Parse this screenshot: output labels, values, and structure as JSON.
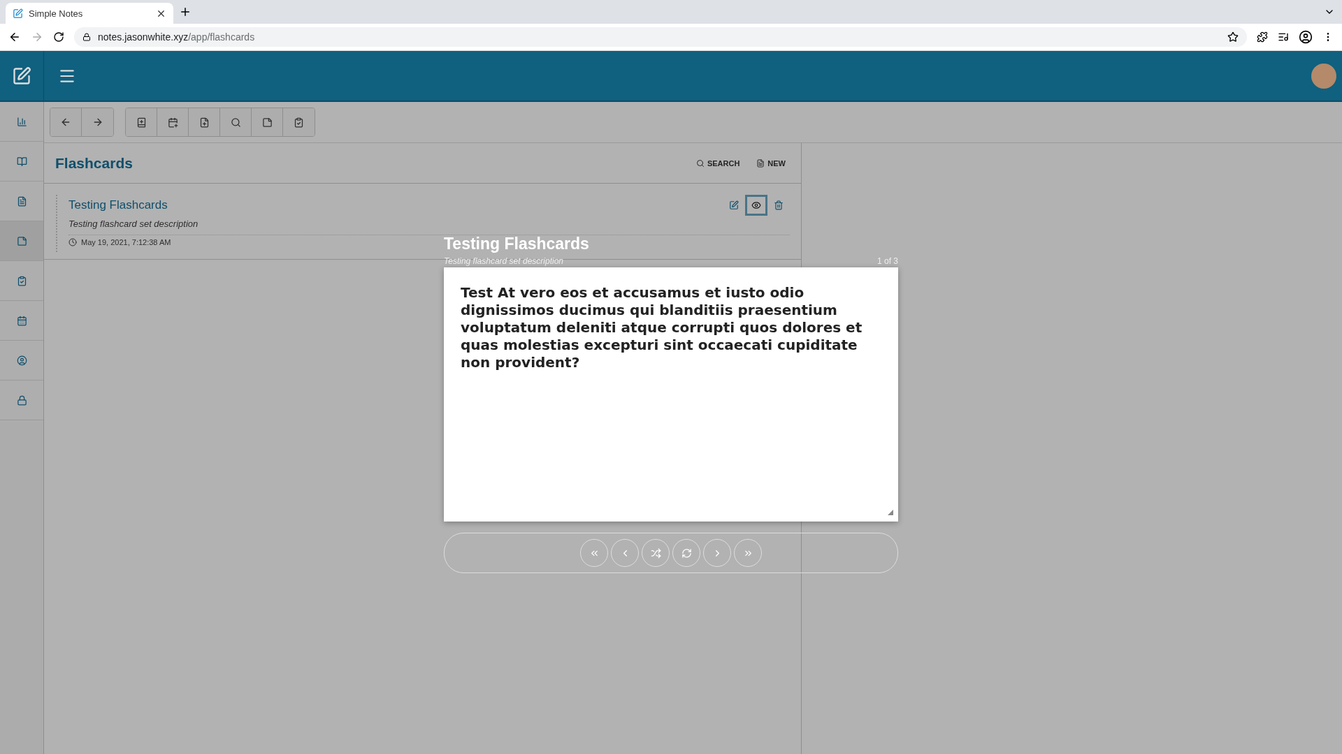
{
  "browser": {
    "tab_title": "Simple Notes",
    "url_host": "notes.jasonwhite.xyz",
    "url_path": "/app/flashcards"
  },
  "sidebar": {
    "items": [
      {
        "kind": "chart",
        "selected": false
      },
      {
        "kind": "book",
        "selected": false
      },
      {
        "kind": "file",
        "selected": false
      },
      {
        "kind": "note",
        "selected": true
      },
      {
        "kind": "clipboard",
        "selected": false
      },
      {
        "kind": "calendar",
        "selected": false
      },
      {
        "kind": "user",
        "selected": false
      },
      {
        "kind": "lock",
        "selected": false
      }
    ]
  },
  "list": {
    "title": "Flashcards",
    "actions": [
      {
        "kind": "search",
        "label": "SEARCH"
      },
      {
        "kind": "new",
        "label": "NEW"
      }
    ],
    "sets": [
      {
        "title": "Testing Flashcards",
        "description": "Testing flashcard set description",
        "date": "May 19, 2021, 7:12:38 AM",
        "viewing": true
      }
    ]
  },
  "viewer": {
    "title": "Testing Flashcards",
    "description": "Testing flashcard set description",
    "position": "1 of 3",
    "card_text": "Test At vero eos et accusamus et iusto odio dignissimos ducimus qui blanditiis praesentium voluptatum deleniti atque corrupti quos dolores et quas molestias excepturi sint occaecati cupiditate non provident?"
  }
}
